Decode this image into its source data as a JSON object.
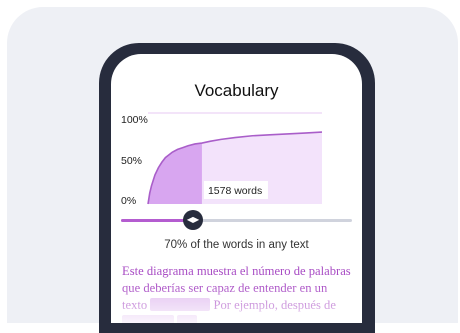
{
  "screen": {
    "title": "Vocabulary",
    "slider_handle_icon": "chevron-left-right-icon",
    "slider_value_fraction": 0.31,
    "caption": "70% of the words in any text",
    "description_parts": [
      "Este diagrama muestra el número de palabras que deberías ser capaz de entender en un texto ",
      " Por ejemplo, después de "
    ]
  },
  "chart_data": {
    "type": "area",
    "title": "",
    "xlabel": "",
    "ylabel": "",
    "ylim": [
      0,
      100
    ],
    "y_ticks": [
      "0%",
      "50%",
      "100%"
    ],
    "x": [
      0.0,
      0.01,
      0.02,
      0.03,
      0.04,
      0.06,
      0.08,
      0.1,
      0.12,
      0.14,
      0.17,
      0.2,
      0.23,
      0.27,
      0.31,
      0.36,
      0.42,
      0.5,
      0.6,
      0.7,
      0.8,
      0.9,
      1.0
    ],
    "series": [
      {
        "values": [
          0,
          12,
          20,
          26,
          32,
          40,
          46,
          51,
          54,
          57,
          60,
          62,
          64,
          66,
          67,
          69,
          71,
          73,
          75,
          76,
          77,
          78,
          79
        ]
      }
    ],
    "marker_label": "1578 words",
    "colors": {
      "line": "#a95ec9",
      "fill_selected": "#d8a6f0",
      "fill_rest": "#f3e3fb"
    }
  }
}
